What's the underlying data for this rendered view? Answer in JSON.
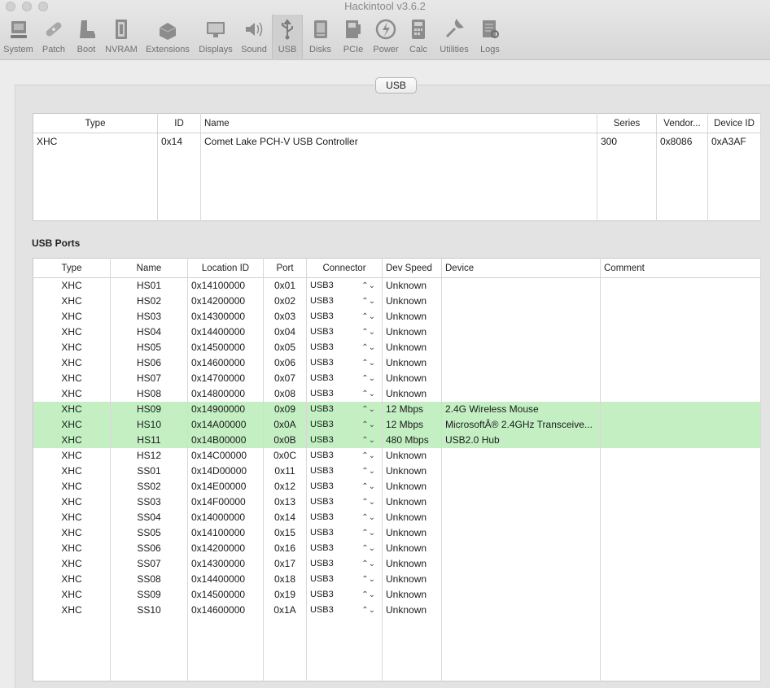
{
  "window": {
    "title": "Hackintool v3.6.2"
  },
  "toolbar": [
    {
      "label": "System",
      "icon": "system-icon",
      "active": false
    },
    {
      "label": "Patch",
      "icon": "patch-icon",
      "active": false
    },
    {
      "label": "Boot",
      "icon": "boot-icon",
      "active": false
    },
    {
      "label": "NVRAM",
      "icon": "nvram-icon",
      "active": false
    },
    {
      "label": "Extensions",
      "icon": "extensions-icon",
      "active": false
    },
    {
      "label": "Displays",
      "icon": "displays-icon",
      "active": false
    },
    {
      "label": "Sound",
      "icon": "sound-icon",
      "active": false
    },
    {
      "label": "USB",
      "icon": "usb-icon",
      "active": true
    },
    {
      "label": "Disks",
      "icon": "disks-icon",
      "active": false
    },
    {
      "label": "PCIe",
      "icon": "pcie-icon",
      "active": false
    },
    {
      "label": "Power",
      "icon": "power-icon",
      "active": false
    },
    {
      "label": "Calc",
      "icon": "calc-icon",
      "active": false
    },
    {
      "label": "Utilities",
      "icon": "utilities-icon",
      "active": false
    },
    {
      "label": "Logs",
      "icon": "logs-icon",
      "active": false
    }
  ],
  "tab": {
    "label": "USB"
  },
  "controllers": {
    "columns": [
      "Type",
      "ID",
      "Name",
      "Series",
      "Vendor...",
      "Device ID"
    ],
    "rows": [
      {
        "type": "XHC",
        "id": "0x14",
        "name": "Comet Lake PCH-V USB Controller",
        "series": "300",
        "vendor": "0x8086",
        "device_id": "0xA3AF"
      }
    ]
  },
  "ports": {
    "section_label": "USB Ports",
    "columns": [
      "Type",
      "Name",
      "Location ID",
      "Port",
      "Connector",
      "Dev Speed",
      "Device",
      "Comment"
    ],
    "highlight_color": "#c3efc3",
    "rows": [
      {
        "type": "XHC",
        "name": "HS01",
        "location": "0x14100000",
        "port": "0x01",
        "connector": "USB3",
        "speed": "Unknown",
        "device": "",
        "comment": "",
        "highlight": false
      },
      {
        "type": "XHC",
        "name": "HS02",
        "location": "0x14200000",
        "port": "0x02",
        "connector": "USB3",
        "speed": "Unknown",
        "device": "",
        "comment": "",
        "highlight": false
      },
      {
        "type": "XHC",
        "name": "HS03",
        "location": "0x14300000",
        "port": "0x03",
        "connector": "USB3",
        "speed": "Unknown",
        "device": "",
        "comment": "",
        "highlight": false
      },
      {
        "type": "XHC",
        "name": "HS04",
        "location": "0x14400000",
        "port": "0x04",
        "connector": "USB3",
        "speed": "Unknown",
        "device": "",
        "comment": "",
        "highlight": false
      },
      {
        "type": "XHC",
        "name": "HS05",
        "location": "0x14500000",
        "port": "0x05",
        "connector": "USB3",
        "speed": "Unknown",
        "device": "",
        "comment": "",
        "highlight": false
      },
      {
        "type": "XHC",
        "name": "HS06",
        "location": "0x14600000",
        "port": "0x06",
        "connector": "USB3",
        "speed": "Unknown",
        "device": "",
        "comment": "",
        "highlight": false
      },
      {
        "type": "XHC",
        "name": "HS07",
        "location": "0x14700000",
        "port": "0x07",
        "connector": "USB3",
        "speed": "Unknown",
        "device": "",
        "comment": "",
        "highlight": false
      },
      {
        "type": "XHC",
        "name": "HS08",
        "location": "0x14800000",
        "port": "0x08",
        "connector": "USB3",
        "speed": "Unknown",
        "device": "",
        "comment": "",
        "highlight": false
      },
      {
        "type": "XHC",
        "name": "HS09",
        "location": "0x14900000",
        "port": "0x09",
        "connector": "USB3",
        "speed": "12 Mbps",
        "device": "2.4G Wireless Mouse",
        "comment": "",
        "highlight": true
      },
      {
        "type": "XHC",
        "name": "HS10",
        "location": "0x14A00000",
        "port": "0x0A",
        "connector": "USB3",
        "speed": "12 Mbps",
        "device": "MicrosoftÂ® 2.4GHz Transceive...",
        "comment": "",
        "highlight": true
      },
      {
        "type": "XHC",
        "name": "HS11",
        "location": "0x14B00000",
        "port": "0x0B",
        "connector": "USB3",
        "speed": "480 Mbps",
        "device": "USB2.0 Hub",
        "comment": "",
        "highlight": true
      },
      {
        "type": "XHC",
        "name": "HS12",
        "location": "0x14C00000",
        "port": "0x0C",
        "connector": "USB3",
        "speed": "Unknown",
        "device": "",
        "comment": "",
        "highlight": false
      },
      {
        "type": "XHC",
        "name": "SS01",
        "location": "0x14D00000",
        "port": "0x11",
        "connector": "USB3",
        "speed": "Unknown",
        "device": "",
        "comment": "",
        "highlight": false
      },
      {
        "type": "XHC",
        "name": "SS02",
        "location": "0x14E00000",
        "port": "0x12",
        "connector": "USB3",
        "speed": "Unknown",
        "device": "",
        "comment": "",
        "highlight": false
      },
      {
        "type": "XHC",
        "name": "SS03",
        "location": "0x14F00000",
        "port": "0x13",
        "connector": "USB3",
        "speed": "Unknown",
        "device": "",
        "comment": "",
        "highlight": false
      },
      {
        "type": "XHC",
        "name": "SS04",
        "location": "0x14000000",
        "port": "0x14",
        "connector": "USB3",
        "speed": "Unknown",
        "device": "",
        "comment": "",
        "highlight": false
      },
      {
        "type": "XHC",
        "name": "SS05",
        "location": "0x14100000",
        "port": "0x15",
        "connector": "USB3",
        "speed": "Unknown",
        "device": "",
        "comment": "",
        "highlight": false
      },
      {
        "type": "XHC",
        "name": "SS06",
        "location": "0x14200000",
        "port": "0x16",
        "connector": "USB3",
        "speed": "Unknown",
        "device": "",
        "comment": "",
        "highlight": false
      },
      {
        "type": "XHC",
        "name": "SS07",
        "location": "0x14300000",
        "port": "0x17",
        "connector": "USB3",
        "speed": "Unknown",
        "device": "",
        "comment": "",
        "highlight": false
      },
      {
        "type": "XHC",
        "name": "SS08",
        "location": "0x14400000",
        "port": "0x18",
        "connector": "USB3",
        "speed": "Unknown",
        "device": "",
        "comment": "",
        "highlight": false
      },
      {
        "type": "XHC",
        "name": "SS09",
        "location": "0x14500000",
        "port": "0x19",
        "connector": "USB3",
        "speed": "Unknown",
        "device": "",
        "comment": "",
        "highlight": false
      },
      {
        "type": "XHC",
        "name": "SS10",
        "location": "0x14600000",
        "port": "0x1A",
        "connector": "USB3",
        "speed": "Unknown",
        "device": "",
        "comment": "",
        "highlight": false
      }
    ]
  }
}
